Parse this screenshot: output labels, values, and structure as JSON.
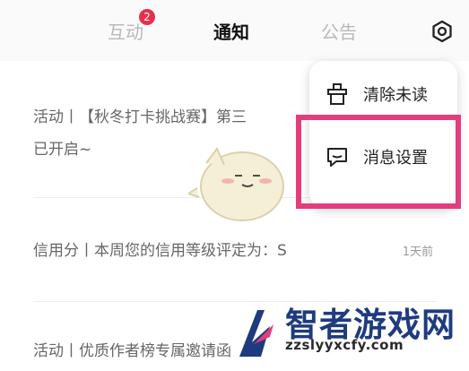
{
  "tabs": [
    {
      "label": "互动",
      "badge": "2"
    },
    {
      "label": "通知"
    },
    {
      "label": "公告"
    }
  ],
  "settings_icon": "settings-icon",
  "notifications": [
    {
      "text": "活动丨【秋冬打卡挑战赛】第三",
      "line2": "已开启~"
    },
    {
      "text": "信用分丨本周您的信用等级评定为：S",
      "time": "1天前"
    },
    {
      "text": "活动丨优质作者榜专属邀请函"
    }
  ],
  "menu": {
    "items": [
      {
        "label": "清除未读",
        "icon": "clear-icon"
      },
      {
        "label": "消息设置",
        "icon": "message-settings-icon"
      }
    ]
  },
  "watermark": {
    "title": "智者游戏网",
    "url": "zzslyyxcfy.com",
    "colors": {
      "primary": "#1f3b7f",
      "highlight": "#e43d7d"
    }
  }
}
